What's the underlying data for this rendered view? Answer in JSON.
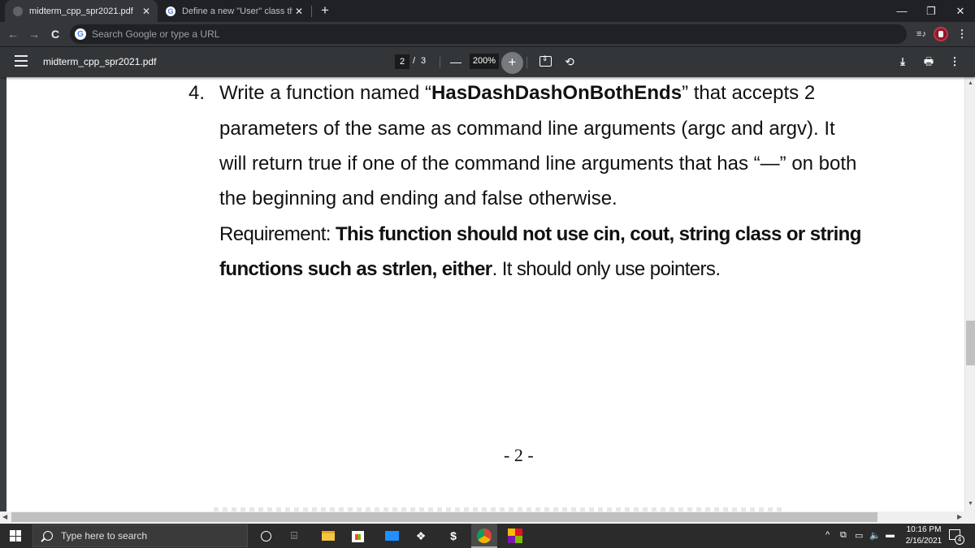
{
  "browser": {
    "tabs": [
      {
        "title": "midterm_cpp_spr2021.pdf",
        "active": true,
        "favicon": "globe-icon"
      },
      {
        "title": "Define a new \"User\" class that co",
        "active": false,
        "favicon": "google-icon"
      }
    ],
    "new_tab_label": "+",
    "window_controls": {
      "minimize": "—",
      "restore": "❐",
      "close": "✕"
    },
    "nav": {
      "back": "←",
      "forward": "→",
      "reload": "C"
    },
    "omnibox": {
      "placeholder": "Search Google or type a URL",
      "icon": "G"
    },
    "toolbar_icons": {
      "media": "≡♪",
      "menu": "⋮"
    }
  },
  "pdf_viewer": {
    "title": "midterm_cpp_spr2021.pdf",
    "current_page": "2",
    "page_separator": "/",
    "total_pages": "3",
    "zoom_out": "—",
    "zoom_level": "200%",
    "zoom_in": "+",
    "rotate": "⟲",
    "download": "⤓",
    "print": "🖶",
    "more": "⋮"
  },
  "document": {
    "question_number": "4.",
    "lines": [
      {
        "pre": "Write a function named “",
        "bold": "HasDashDashOnBothEnds",
        "post": "” that accepts 2"
      },
      {
        "text": "parameters of the same as command line arguments (argc and argv). It"
      },
      {
        "text": "will return true if one of the command line arguments that has “—” on both"
      },
      {
        "text": "the beginning and ending and false otherwise."
      },
      {
        "pre": "Requirement: ",
        "bold": "This function should not use cin, cout, string class or string"
      },
      {
        "bold": "functions such as strlen, either",
        "post": ". It should only use pointers."
      }
    ],
    "page_footer": "- 2 -"
  },
  "taskbar": {
    "search_placeholder": "Type here to search",
    "apps": [
      "cortana-icon",
      "task-view-icon",
      "file-explorer-icon",
      "store-icon",
      "mail-icon",
      "dropbox-icon",
      "app-s-icon",
      "chrome-icon",
      "color-app-icon"
    ],
    "time": "10:16 PM",
    "date": "2/16/2021",
    "notification_count": "4"
  }
}
